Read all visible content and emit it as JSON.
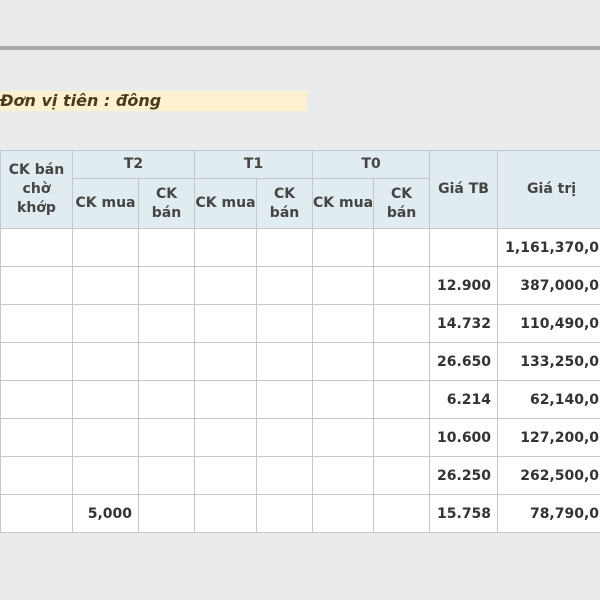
{
  "page": {
    "unit_label": "Đơn vị tiên : đông"
  },
  "table": {
    "headers": {
      "ck_ban_cho_khop": "CK bán chờ khớp",
      "t2": "T2",
      "t1": "T1",
      "t0": "T0",
      "ck_mua": "CK mua",
      "ck_ban": "CK bán",
      "gia_tb": "Giá TB",
      "gia_tri": "Giá trị"
    },
    "rows": [
      {
        "cho_khop": "",
        "t2_mua": "",
        "t2_ban": "",
        "t1_mua": "",
        "t1_ban": "",
        "t0_mua": "",
        "t0_ban": "",
        "gia_tb": "",
        "gia_tri": "1,161,370,0"
      },
      {
        "cho_khop": "",
        "t2_mua": "",
        "t2_ban": "",
        "t1_mua": "",
        "t1_ban": "",
        "t0_mua": "",
        "t0_ban": "",
        "gia_tb": "12.900",
        "gia_tri": "387,000,0"
      },
      {
        "cho_khop": "",
        "t2_mua": "",
        "t2_ban": "",
        "t1_mua": "",
        "t1_ban": "",
        "t0_mua": "",
        "t0_ban": "",
        "gia_tb": "14.732",
        "gia_tri": "110,490,0"
      },
      {
        "cho_khop": "",
        "t2_mua": "",
        "t2_ban": "",
        "t1_mua": "",
        "t1_ban": "",
        "t0_mua": "",
        "t0_ban": "",
        "gia_tb": "26.650",
        "gia_tri": "133,250,0"
      },
      {
        "cho_khop": "",
        "t2_mua": "",
        "t2_ban": "",
        "t1_mua": "",
        "t1_ban": "",
        "t0_mua": "",
        "t0_ban": "",
        "gia_tb": "6.214",
        "gia_tri": "62,140,0"
      },
      {
        "cho_khop": "",
        "t2_mua": "",
        "t2_ban": "",
        "t1_mua": "",
        "t1_ban": "",
        "t0_mua": "",
        "t0_ban": "",
        "gia_tb": "10.600",
        "gia_tri": "127,200,0"
      },
      {
        "cho_khop": "",
        "t2_mua": "",
        "t2_ban": "",
        "t1_mua": "",
        "t1_ban": "",
        "t0_mua": "",
        "t0_ban": "",
        "gia_tb": "26.250",
        "gia_tri": "262,500,0"
      },
      {
        "cho_khop": "",
        "t2_mua": "5,000",
        "t2_ban": "",
        "t1_mua": "",
        "t1_ban": "",
        "t0_mua": "",
        "t0_ban": "",
        "gia_tb": "15.758",
        "gia_tri": "78,790,0"
      }
    ]
  },
  "colors": {
    "header_bg": "#e0ecf0",
    "unit_bar_bg": "#fdf1cf",
    "page_bg": "#e9ebec"
  }
}
